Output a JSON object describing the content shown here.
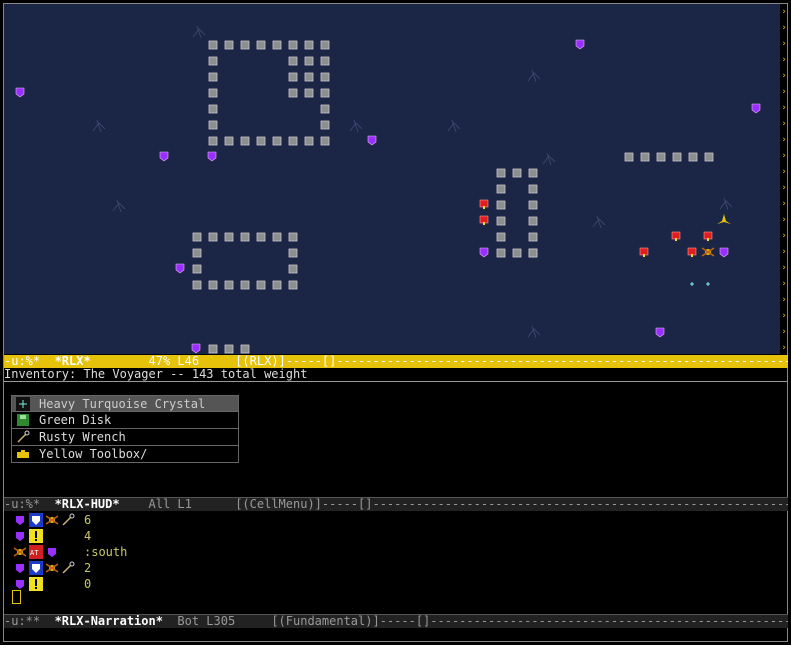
{
  "map": {
    "background": "#1b2545",
    "wall_color": "#8e8e8e",
    "gem_color": "#9a30ff",
    "red_color": "#e02020",
    "player_color": "#e6c20a",
    "fringe_glyph": "›"
  },
  "modeline_main": {
    "prefix": "-u:%*  ",
    "name": "*RLX*",
    "rest": "        47% L46     [(RLX)]-----[]------------------------------------------------------------------------"
  },
  "echo_text": "Inventory: The Voyager -- 143 total weight",
  "inventory": [
    {
      "label": "Heavy Turquoise Crystal",
      "icon": "crystal-icon",
      "selected": true
    },
    {
      "label": "Green Disk",
      "icon": "disk-icon",
      "selected": false
    },
    {
      "label": "Rusty Wrench",
      "icon": "wrench-icon",
      "selected": false
    },
    {
      "label": "Yellow Toolbox/",
      "icon": "toolbox-icon",
      "selected": false
    }
  ],
  "modeline_hud": {
    "prefix": "-u:%*  ",
    "name": "*RLX-HUD*",
    "rest": "    All L1      [(CellMenu)]-----[]------------------------------------------------------------------"
  },
  "hud_rows": [
    {
      "icons": [
        "gem-icon",
        "shield-icon",
        "robot-icon",
        "wrench-icon"
      ],
      "text": "6"
    },
    {
      "icons": [
        "gem-icon",
        "alert-icon",
        "blank",
        "blank"
      ],
      "text": "4"
    },
    {
      "icons": [
        "robot-icon",
        "at-icon",
        "gem-icon",
        "blank"
      ],
      "text": ":south"
    },
    {
      "icons": [
        "gem-icon",
        "shield-icon",
        "robot-icon",
        "wrench-icon"
      ],
      "text": "2"
    },
    {
      "icons": [
        "gem-icon",
        "alert-icon",
        "blank",
        "blank"
      ],
      "text": "0"
    }
  ],
  "modeline_narration": {
    "prefix": "-u:**  ",
    "name": "*RLX-Narration*",
    "rest": "  Bot L305     [(Fundamental)]-----[]----------------------------------------------------------------"
  }
}
